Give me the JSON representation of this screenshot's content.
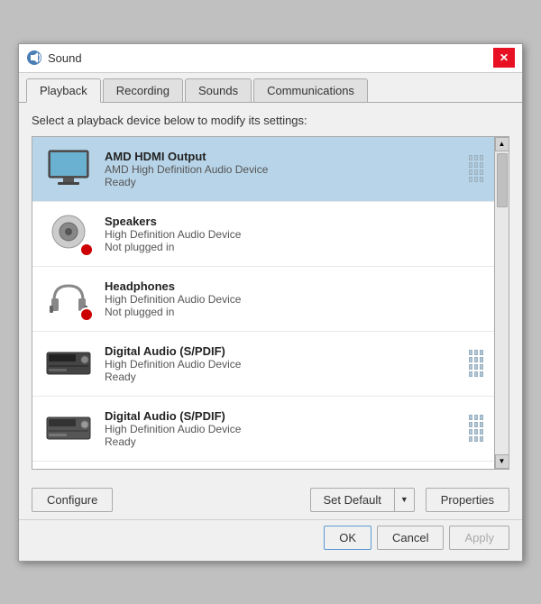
{
  "titleBar": {
    "title": "Sound",
    "iconAlt": "sound-icon"
  },
  "tabs": [
    {
      "label": "Playback",
      "active": true
    },
    {
      "label": "Recording",
      "active": false
    },
    {
      "label": "Sounds",
      "active": false
    },
    {
      "label": "Communications",
      "active": false
    }
  ],
  "instruction": "Select a playback device below to modify its settings:",
  "devices": [
    {
      "name": "AMD HDMI Output",
      "driver": "AMD High Definition Audio Device",
      "status": "Ready",
      "icon": "monitor",
      "selected": true,
      "showBars": true
    },
    {
      "name": "Speakers",
      "driver": "High Definition Audio Device",
      "status": "Not plugged in",
      "icon": "speaker",
      "selected": false,
      "showBars": false,
      "badge": true
    },
    {
      "name": "Headphones",
      "driver": "High Definition Audio Device",
      "status": "Not plugged in",
      "icon": "headphone",
      "selected": false,
      "showBars": false,
      "badge": true
    },
    {
      "name": "Digital Audio (S/PDIF)",
      "driver": "High Definition Audio Device",
      "status": "Ready",
      "icon": "digital",
      "selected": false,
      "showBars": true
    },
    {
      "name": "Digital Audio (S/PDIF)",
      "driver": "High Definition Audio Device",
      "status": "Ready",
      "icon": "digital2",
      "selected": false,
      "showBars": true
    }
  ],
  "buttons": {
    "configure": "Configure",
    "setDefault": "Set Default",
    "properties": "Properties",
    "ok": "OK",
    "cancel": "Cancel",
    "apply": "Apply"
  }
}
